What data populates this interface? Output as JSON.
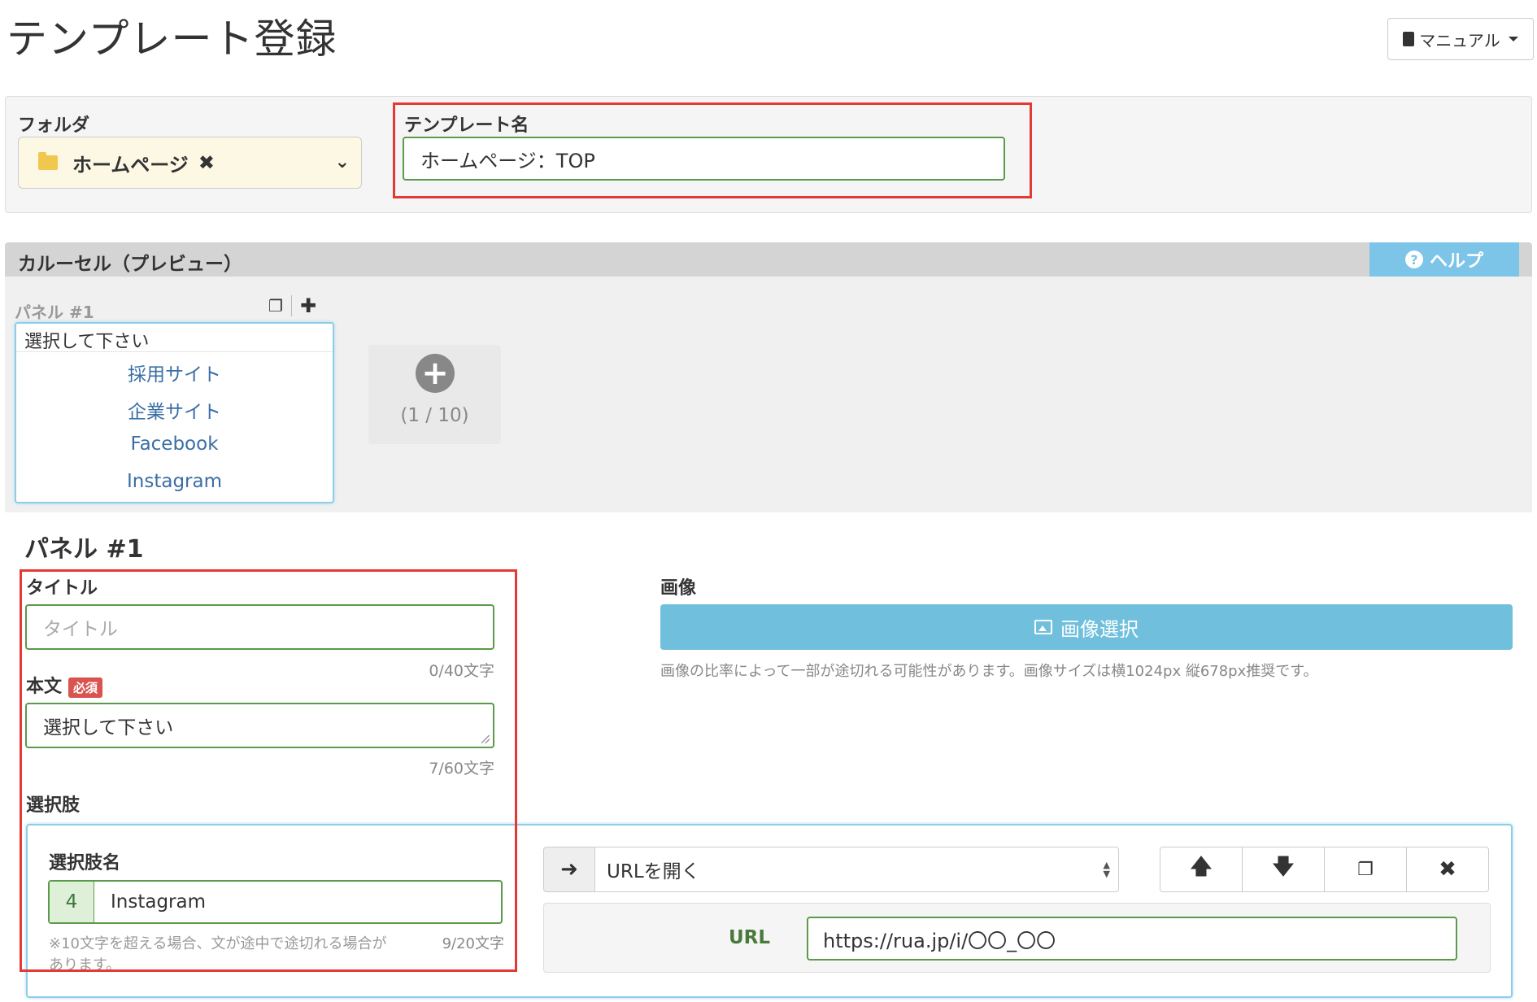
{
  "page": {
    "title": "テンプレート登録",
    "manual_label": "マニュアル"
  },
  "folder": {
    "label": "フォルダ",
    "value": "ホームページ"
  },
  "template_name": {
    "label": "テンプレート名",
    "value": "ホームページ：TOP"
  },
  "carousel": {
    "title": "カルーセル（プレビュー）",
    "help_label": "ヘルプ",
    "tab_label": "パネル #1",
    "preview": {
      "title": "選択して下さい",
      "options": [
        "採用サイト",
        "企業サイト",
        "Facebook",
        "Instagram"
      ]
    },
    "add_count": "(1 / 10)"
  },
  "panel": {
    "heading": "パネル #1",
    "title_label": "タイトル",
    "title_placeholder": "タイトル",
    "title_counter": "0/40文字",
    "body_label": "本文",
    "required_badge": "必須",
    "body_value": "選択して下さい",
    "body_counter": "7/60文字",
    "choices_label": "選択肢",
    "image_label": "画像",
    "image_button": "画像選択",
    "image_note": "画像の比率によって一部が途切れる可能性があります。画像サイズは横1024px 縦678px推奨です。"
  },
  "choice": {
    "name_label": "選択肢名",
    "number": "4",
    "name_value": "Instagram",
    "note": "※10文字を超える場合、文が途中で途切れる場合があります。",
    "counter": "9/20文字",
    "action_value": "URLを開く",
    "url_label": "URL",
    "url_value": "https://rua.jp/i/〇〇_〇〇"
  }
}
